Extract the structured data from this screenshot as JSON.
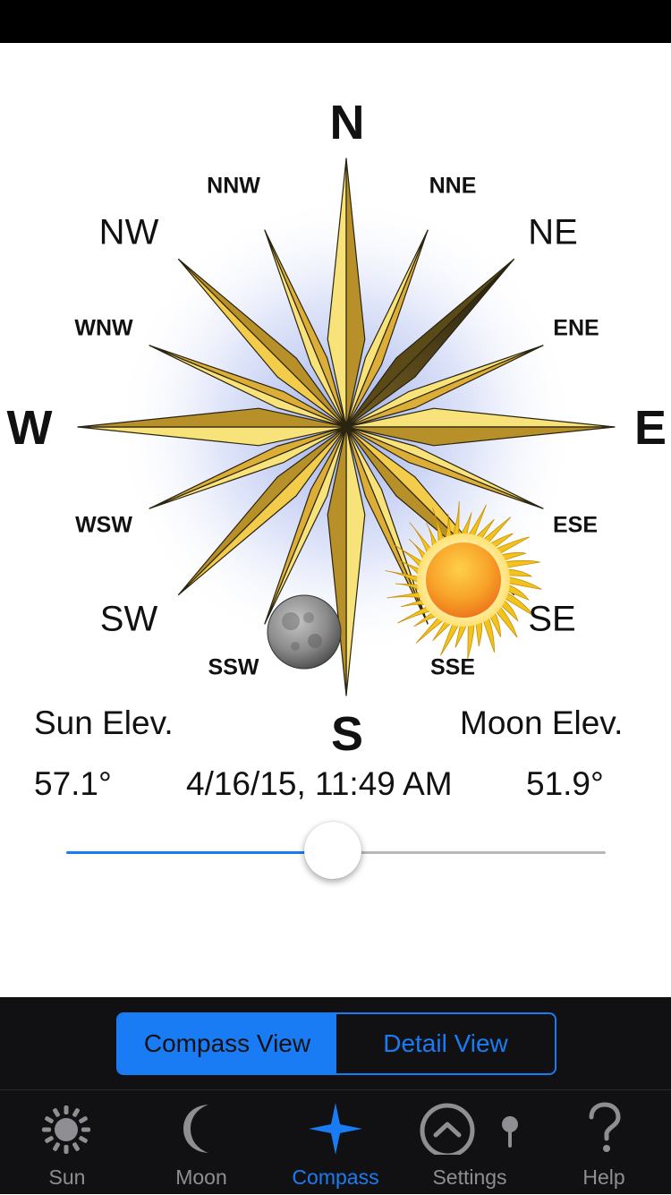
{
  "compass": {
    "cardinal": {
      "n": "N",
      "e": "E",
      "s": "S",
      "w": "W"
    },
    "intercardinal": {
      "ne": "NE",
      "se": "SE",
      "sw": "SW",
      "nw": "NW"
    },
    "minor": {
      "nne": "NNE",
      "ene": "ENE",
      "ese": "ESE",
      "sse": "SSE",
      "ssw": "SSW",
      "wsw": "WSW",
      "wnw": "WNW",
      "nnw": "NNW"
    }
  },
  "info": {
    "sun_label": "Sun Elev.",
    "moon_label": "Moon Elev.",
    "sun_value": "57.1°",
    "datetime": "4/16/15, 11:49 AM",
    "moon_value": "51.9°"
  },
  "slider": {
    "fraction": 0.495
  },
  "segment": {
    "compass": "Compass View",
    "detail": "Detail View"
  },
  "tabs": {
    "sun": "Sun",
    "moon": "Moon",
    "compass": "Compass",
    "settings": "Settings",
    "help": "Help"
  },
  "colors": {
    "accent": "#1a7cf5",
    "star_gold": "#f0c64a",
    "bar_bg": "#111113"
  }
}
